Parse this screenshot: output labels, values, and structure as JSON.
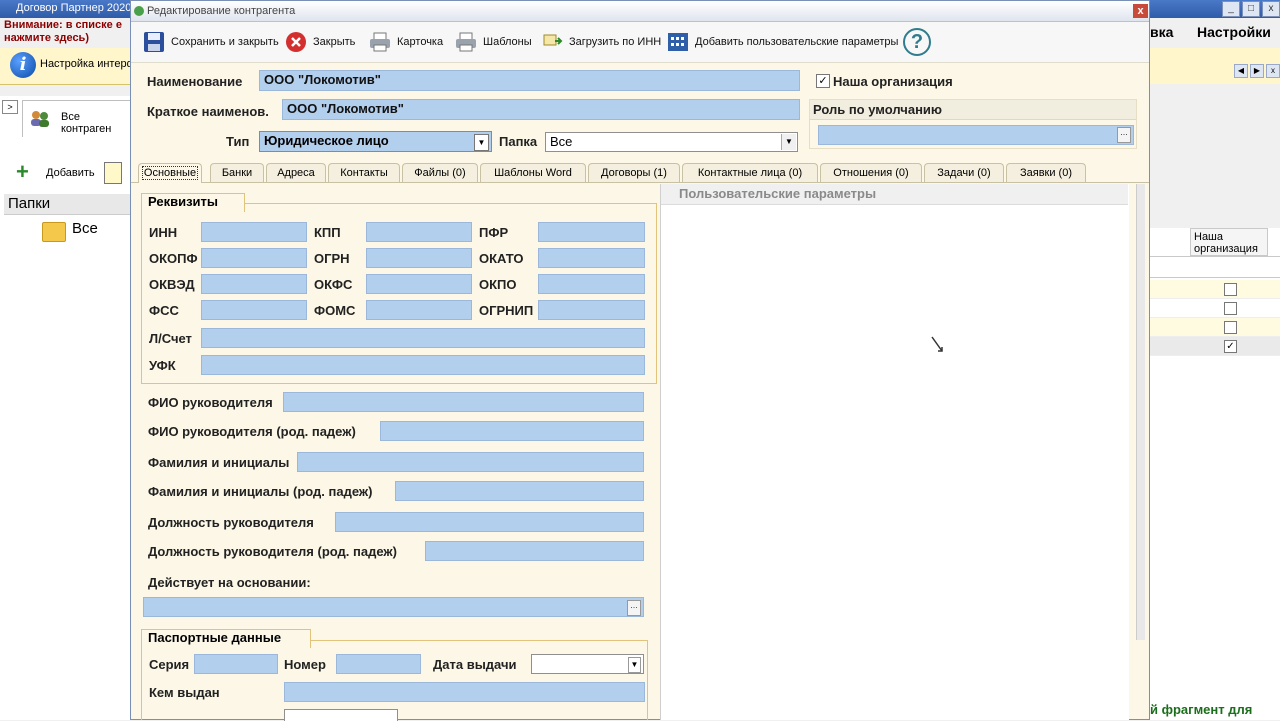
{
  "app": {
    "title": "Договор Партнер 2020",
    "warning": "Внимание: в списке е нажмите здесь)",
    "menu": {
      "item_1": "вка",
      "item_2": "Настройки"
    },
    "info_text": "Настройка интерф",
    "tab_all": "Все контраген",
    "add_label": "Добавить",
    "folders_header": "Папки",
    "folder_all": "Все",
    "grid": {
      "col_header": "Наша организация",
      "rows": [
        {
          "checked": false
        },
        {
          "checked": false
        },
        {
          "checked": false
        },
        {
          "checked": true
        }
      ]
    },
    "bottom_text": "й фрагмент для"
  },
  "dialog": {
    "title": "Редактирование контрагента",
    "close_glyph": "x",
    "toolbar": {
      "save_close": "Сохранить и закрыть",
      "close": "Закрыть",
      "card": "Карточка",
      "templates": "Шаблоны",
      "load_inn": "Загрузить по ИНН",
      "add_params": "Добавить пользовательские параметры",
      "help_glyph": "?"
    },
    "header": {
      "name_label": "Наименование",
      "name_value": "ООО \"Локомотив\"",
      "short_label": "Краткое наименов.",
      "short_value": "ООО \"Локомотив\"",
      "type_label": "Тип",
      "type_value": "Юридическое лицо",
      "folder_label": "Папка",
      "folder_value": "Все",
      "our_org_label": "Наша организация",
      "our_org_checked": true,
      "role_label": "Роль по умолчанию"
    },
    "tabs": [
      {
        "label": "Основные",
        "active": true
      },
      {
        "label": "Банки"
      },
      {
        "label": "Адреса"
      },
      {
        "label": "Контакты"
      },
      {
        "label": "Файлы (0)"
      },
      {
        "label": "Шаблоны Word"
      },
      {
        "label": "Договоры (1)"
      },
      {
        "label": "Контактные лица (0)"
      },
      {
        "label": "Отношения (0)"
      },
      {
        "label": "Задачи (0)"
      },
      {
        "label": "Заявки (0)"
      }
    ],
    "requisites": {
      "title": "Реквизиты",
      "inn": "ИНН",
      "kpp": "КПП",
      "pfr": "ПФР",
      "okopf": "ОКОПФ",
      "ogrn": "ОГРН",
      "okato": "ОКАТО",
      "okved": "ОКВЭД",
      "okfs": "ОКФС",
      "okpo": "ОКПО",
      "fss": "ФСС",
      "foms": "ФОМС",
      "ogrnip": "ОГРНИП",
      "account": "Л/Счет",
      "ufk": "УФК"
    },
    "head": {
      "fio": "ФИО руководителя",
      "fio_gen": "ФИО руководителя (род. падеж)",
      "initials": "Фамилия и инициалы",
      "initials_gen": "Фамилия и инициалы (род. падеж)",
      "position": "Должность руководителя",
      "position_gen": "Должность руководителя (род. падеж)",
      "basis": "Действует на основании:"
    },
    "passport": {
      "title": "Паспортные данные",
      "series": "Серия",
      "number": "Номер",
      "issue_date": "Дата выдачи",
      "issued_by": "Кем выдан"
    },
    "user_params_header": "Пользовательские параметры"
  }
}
